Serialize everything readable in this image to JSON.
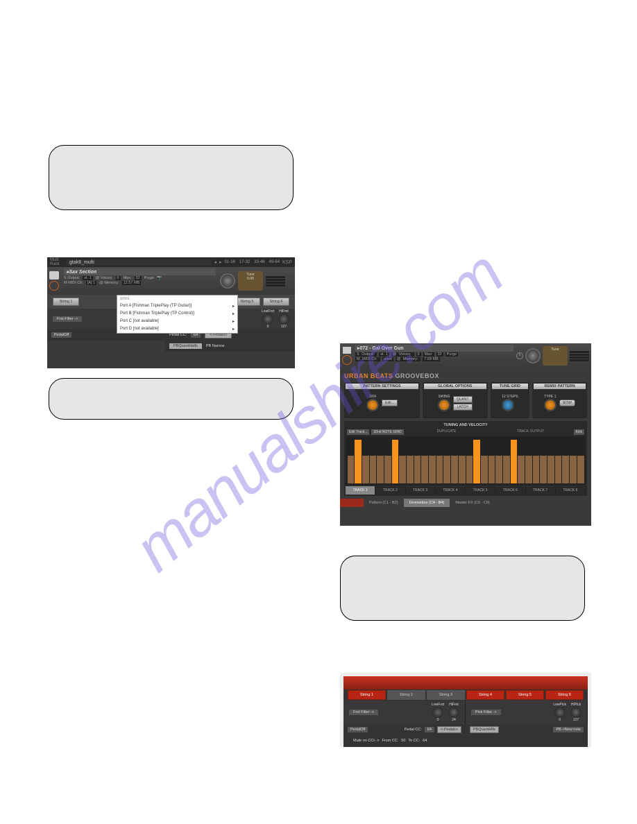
{
  "watermark": "manualshire.com",
  "panel1": {
    "multi_label": "Multi Rack",
    "title": "gtak6_multi",
    "timecodes": [
      "01-16",
      "17-32",
      "33-48",
      "49-64"
    ],
    "ksp": "KSP",
    "instrument": "Sax Section",
    "output_lbl": "Output:",
    "output_val": "st. 1",
    "voices_lbl": "Voices:",
    "voices_val": "0",
    "max_lbl": "Max:",
    "max_val": "32",
    "purge": "Purge",
    "midi_lbl": "MIDI Ch:",
    "midi_val": "[A] 1",
    "memory_lbl": "Memory:",
    "memory_val": "12.57 MB",
    "tune_lbl": "Tune",
    "tune_val": "0.00",
    "dropdown": {
      "header": "omni",
      "items": [
        "Port A [Fishman TriplePlay (TP Guitar)]",
        "Port B [Fishman TriplePlay (TP Control)]",
        "Port C [not available]",
        "Port D [not available]"
      ]
    },
    "strings": [
      "String 1",
      "String 5",
      "String 6"
    ],
    "filter": {
      "label": "Fret Filter ->",
      "low": "LowFret",
      "low_v": "0",
      "hi": "HiFret",
      "hi_v": "127"
    },
    "pedal": {
      "drop": "PedalOff",
      "cc": "Pedal CC:",
      "cc_v": "64",
      "btn": "<-Pedals>"
    },
    "quant": {
      "a": "PBQuantHalfs",
      "b": "PB Narrow"
    }
  },
  "panel2": {
    "name": "072 - Gal Over Gun",
    "output_lbl": "Output:",
    "output_val": "st. 1",
    "voices_lbl": "Voices:",
    "voices_val": "0",
    "max_lbl": "Max:",
    "max_val": "32",
    "purge": "Purge",
    "midi_lbl": "MIDI Ch:",
    "midi_val": "omni",
    "memory_lbl": "Memory:",
    "memory_val": "7.69 MB",
    "tune_lbl": "Tune",
    "title_a": "URBAN BEATS",
    "title_b": " GROOVEBOX",
    "sections": {
      "pattern": {
        "hd": "PATTERN SETTINGS",
        "k": "1/04",
        "drop": "Edit..."
      },
      "global": {
        "hd": "GLOBAL OPTIONS",
        "k": "SWING",
        "b1": "QUANT",
        "b2": "LATCH"
      },
      "tune": {
        "hd": "TUNE GRID",
        "k": "12 STEPS"
      },
      "remix": {
        "hd": "REMIX PATTERN",
        "k": "TYPE 1",
        "now": "NOW!"
      }
    },
    "tv": {
      "hd": "TUNING AND VELOCITY",
      "edit": "Edit Track...",
      "grid": "32nd NOTE GRID",
      "dup": "DUPLICATE",
      "out": "TRACK OUTPUT",
      "out_v": "Kick"
    },
    "grid_hi": [
      1,
      6,
      17,
      22
    ],
    "tracks": [
      "TRACK 1",
      "TRACK 2",
      "TRACK 3",
      "TRACK 4",
      "TRACK 5",
      "TRACK 6",
      "TRACK 7",
      "TRACK 8"
    ],
    "tabs": [
      "",
      "Pattern (C1 - B2)",
      "Groovebox (C4 - B4)",
      "Master FX (C6 - C8)"
    ]
  },
  "panel3": {
    "strings": [
      {
        "l": "String 1",
        "on": true
      },
      {
        "l": "String 2",
        "on": false
      },
      {
        "l": "String 3",
        "on": false
      },
      {
        "l": "String 4",
        "on": true
      },
      {
        "l": "String 5",
        "on": true
      },
      {
        "l": "String 6",
        "on": true
      }
    ],
    "filt_l": {
      "lbl": "Fret Filter ->",
      "a": "LowFret",
      "av": "0",
      "b": "HiFret",
      "bv": "24"
    },
    "filt_r": {
      "lbl": "Pick Filter ->",
      "a": "LowPick",
      "av": "0",
      "b": "HiPick",
      "bv": "127"
    },
    "ped_l": {
      "drop": "PedalOff",
      "cc": "Pedal CC:",
      "ccv": "64",
      "btn": "<-Pedals>"
    },
    "ped_r": {
      "a": "PBQuantHlfs",
      "b": "PB->New note"
    },
    "mute": {
      "lbl": "Mute on CCt ->",
      "f": "From CC:",
      "fv": "50",
      "t": "To CC:",
      "tv": "64"
    }
  }
}
